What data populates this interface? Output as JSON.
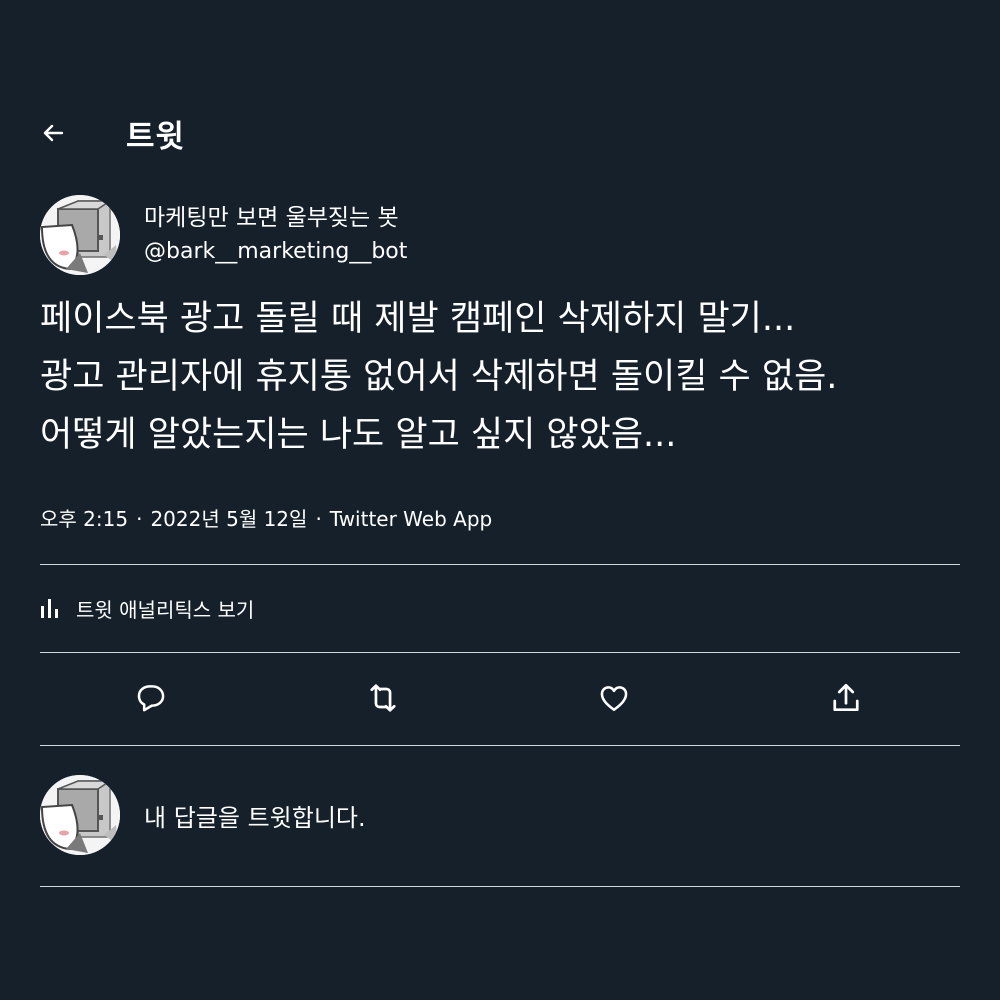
{
  "header": {
    "back_icon": "arrow-left-icon",
    "title": "트윗"
  },
  "author": {
    "name": "마케팅만 보면 울부짖는 봇",
    "handle": "@bark__marketing__bot",
    "avatar_icon": "robot-avatar"
  },
  "tweet": {
    "lines": [
      "페이스북 광고 돌릴 때 제발 캠페인 삭제하지 말기...",
      "광고 관리자에 휴지통 없어서 삭제하면 돌이킬 수 없음.",
      "어떻게 알았는지는 나도 알고 싶지 않았음..."
    ]
  },
  "meta": {
    "time": "오후 2:15",
    "date": "2022년 5월 12일",
    "source": "Twitter Web App",
    "separator": "·"
  },
  "analytics": {
    "icon": "bar-chart-icon",
    "label": "트윗 애널리틱스 보기"
  },
  "actions": [
    {
      "name": "reply",
      "icon": "reply-icon"
    },
    {
      "name": "retweet",
      "icon": "retweet-icon"
    },
    {
      "name": "like",
      "icon": "heart-icon"
    },
    {
      "name": "share",
      "icon": "share-icon"
    }
  ],
  "reply": {
    "placeholder": "내 답글을 트윗합니다."
  },
  "colors": {
    "background": "#15202b",
    "text": "#ffffff",
    "divider": "#cfd6dc"
  }
}
